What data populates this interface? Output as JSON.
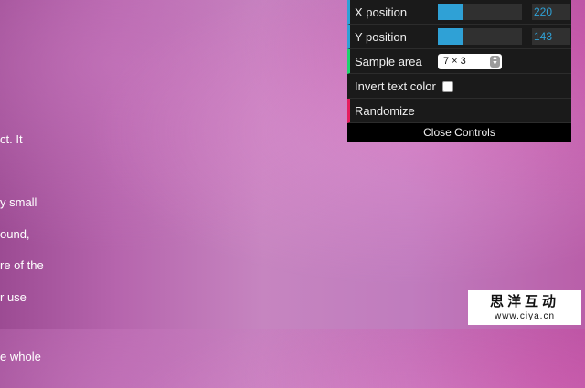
{
  "background_text": {
    "para1": [
      "ct. It",
      "y small",
      "re of the"
    ],
    "para2": [
      "ound,",
      "r use"
    ],
    "para3": [
      "e whole"
    ]
  },
  "controls": {
    "x_position": {
      "label": "X position",
      "value": "220",
      "fraction": 0.29
    },
    "y_position": {
      "label": "Y position",
      "value": "143",
      "fraction": 0.29
    },
    "sample_area": {
      "label": "Sample area",
      "selected": "7 × 3"
    },
    "invert": {
      "label": "Invert text color",
      "checked": false
    },
    "randomize": {
      "label": "Randomize"
    },
    "close_label": "Close Controls"
  },
  "colors": {
    "accent_blue": "#2fa1d6",
    "accent_green": "#1ed36f",
    "accent_red": "#e61d5f"
  },
  "watermark": {
    "big": "思洋互动",
    "small": "www.ciya.cn"
  }
}
